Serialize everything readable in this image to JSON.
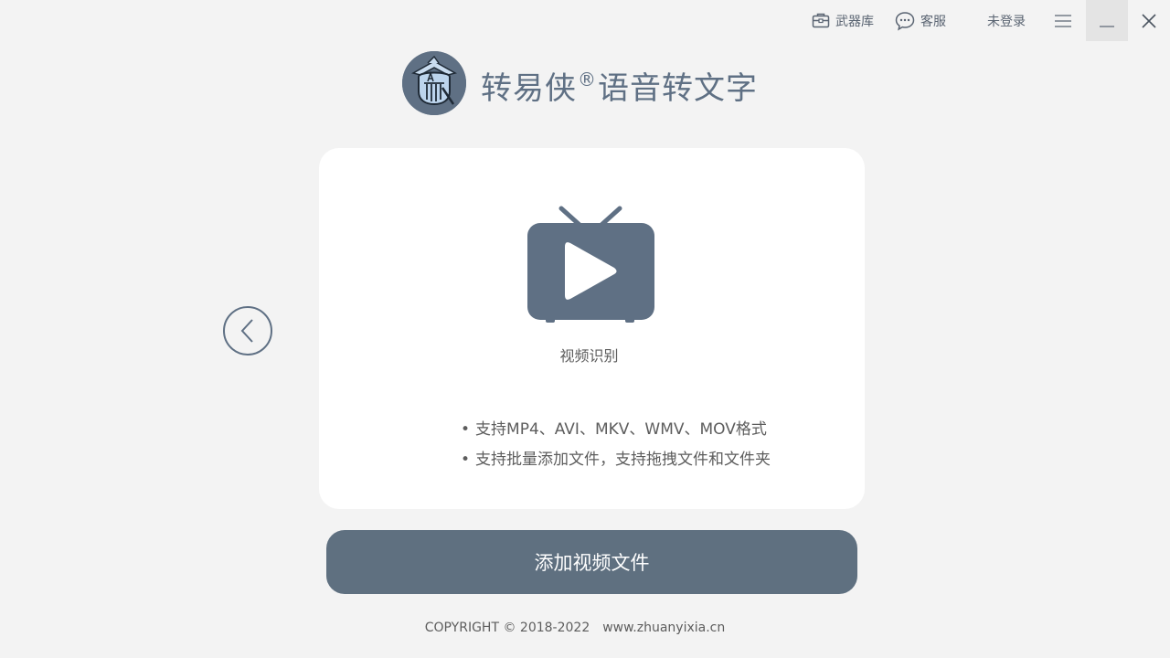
{
  "titlebar": {
    "weapon_label": "武器库",
    "service_label": "客服",
    "login_label": "未登录",
    "menu_icon": "hamburger-menu-icon",
    "minimize_icon": "minimize-icon",
    "close_icon": "close-icon"
  },
  "brand": {
    "name_part1": "转易侠",
    "registered_mark": "®",
    "name_part2": "语音转文字"
  },
  "card": {
    "icon": "tv-play-icon",
    "feature_label": "视频识别",
    "features": [
      "支持MP4、AVI、MKV、WMV、MOV格式",
      "支持批量添加文件，支持拖拽文件和文件夹"
    ]
  },
  "nav": {
    "prev_icon": "chevron-left-icon"
  },
  "actions": {
    "add_video_label": "添加视频文件"
  },
  "footer": {
    "copyright": "COPYRIGHT © 2018-2022",
    "website": "www.zhuanyixia.cn"
  },
  "colors": {
    "background": "#f3f3f3",
    "accent": "#5f7080",
    "card": "#ffffff",
    "text": "#5d5d5d"
  }
}
